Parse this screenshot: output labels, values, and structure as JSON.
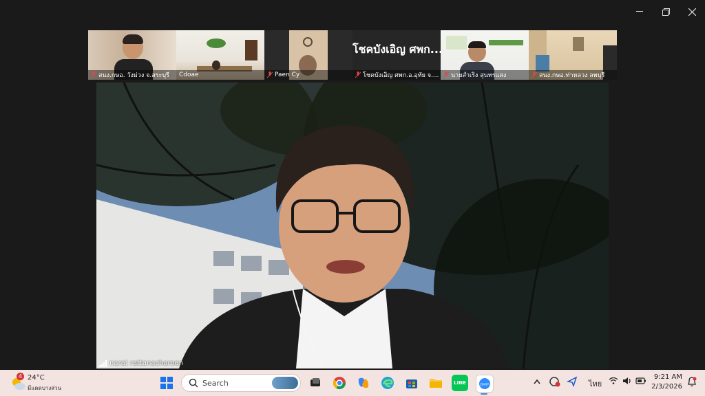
{
  "window": {
    "controls": [
      "minimize",
      "restore",
      "close"
    ]
  },
  "participants": [
    {
      "name": "สนง.กษอ. วังม่วง จ.สระบุรี",
      "muted": true
    },
    {
      "name": "Cdoae",
      "muted": false
    },
    {
      "name": "Paen Cy",
      "muted": true
    },
    {
      "name": "โชคบังเอิญ  ศพก.อ.อุทัย จ....",
      "muted": true,
      "display_text": "โชคบังเอิญ  ศพก...."
    },
    {
      "name": "นายสำเริง สุนทรแสง",
      "muted": true
    },
    {
      "name": "สนง.กษอ.ท่าหลวง ลพบุรี",
      "muted": true
    }
  ],
  "active_speaker": {
    "name": "narat rattanacharoen"
  },
  "taskbar": {
    "weather": {
      "temp": "24°C",
      "desc": "มีแดดบางส่วน",
      "badge": "4"
    },
    "search_placeholder": "Search",
    "pinned_icons": [
      "task-view-icon",
      "chrome-icon",
      "copilot-icon",
      "edge-icon",
      "store-icon",
      "file-explorer-icon",
      "line-icon",
      "zoom-icon"
    ],
    "tray": {
      "language": "ไทย"
    },
    "clock": {
      "time": "9:21 AM",
      "date": "2/3/2026"
    }
  }
}
